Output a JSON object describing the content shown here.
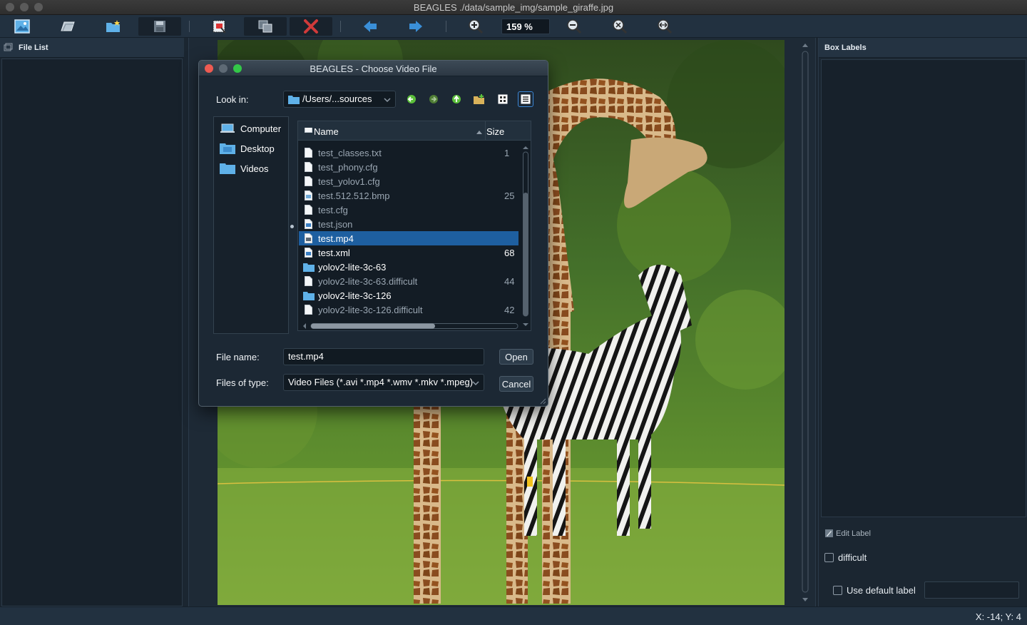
{
  "window": {
    "title": "BEAGLES ./data/sample_img/sample_giraffe.jpg"
  },
  "toolbar": {
    "zoom_value": "159 %"
  },
  "left_panel": {
    "title": "File List"
  },
  "right_panel": {
    "title": "Box Labels",
    "edit_label": "Edit Label",
    "difficult_label": "difficult",
    "use_default_label": "Use default label",
    "default_label_value": ""
  },
  "statusbar": {
    "coords": "X: -14; Y: 4"
  },
  "dialog": {
    "title": "BEAGLES - Choose Video File",
    "look_in_label": "Look in:",
    "look_in_value": "/Users/...sources",
    "sidebar": [
      {
        "label": "Computer"
      },
      {
        "label": "Desktop"
      },
      {
        "label": "Videos"
      }
    ],
    "columns": {
      "name": "Name",
      "size": "Size"
    },
    "files": [
      {
        "name": "test_classes.txt",
        "size": "1",
        "type": "file",
        "style": "dim"
      },
      {
        "name": "test_phony.cfg",
        "size": "",
        "type": "file",
        "style": "dim"
      },
      {
        "name": "test_yolov1.cfg",
        "size": "",
        "type": "file",
        "style": "dim"
      },
      {
        "name": "test.512.512.bmp",
        "size": "25",
        "type": "image",
        "style": "dim"
      },
      {
        "name": "test.cfg",
        "size": "",
        "type": "file",
        "style": "dim"
      },
      {
        "name": "test.json",
        "size": "",
        "type": "doc",
        "style": "dim"
      },
      {
        "name": "test.mp4",
        "size": "",
        "type": "video",
        "style": "selected"
      },
      {
        "name": "test.xml",
        "size": "68",
        "type": "doc",
        "style": "bright"
      },
      {
        "name": "yolov2-lite-3c-63",
        "size": "",
        "type": "folder",
        "style": "bright"
      },
      {
        "name": "yolov2-lite-3c-63.difficult",
        "size": "44",
        "type": "file",
        "style": "dim"
      },
      {
        "name": "yolov2-lite-3c-126",
        "size": "",
        "type": "folder",
        "style": "bright"
      },
      {
        "name": "yolov2-lite-3c-126.difficult",
        "size": "42",
        "type": "file",
        "style": "dim"
      }
    ],
    "file_name_label": "File name:",
    "file_name_value": "test.mp4",
    "files_of_type_label": "Files of type:",
    "files_of_type_value": "Video Files (*.avi *.mp4 *.wmv *.mkv *.mpeg)",
    "open_label": "Open",
    "cancel_label": "Cancel"
  }
}
